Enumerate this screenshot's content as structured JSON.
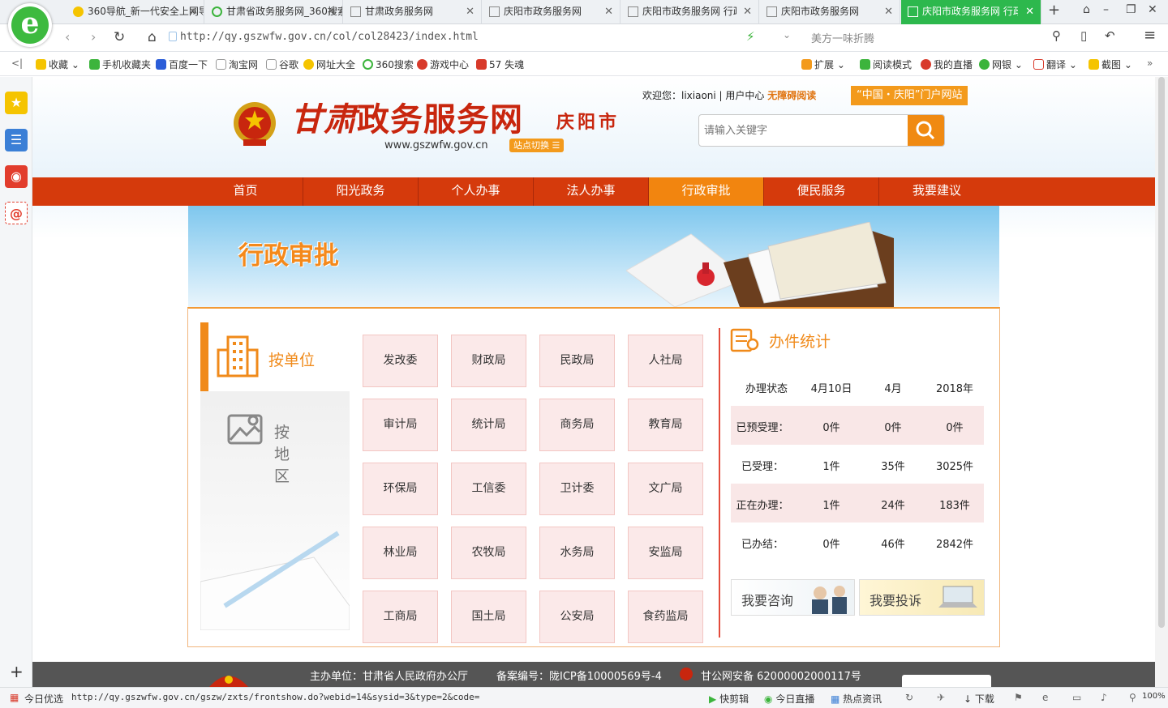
{
  "tabs": [
    {
      "label": "360导航_新一代安全上网导航",
      "icon": "360-nav-icon"
    },
    {
      "label": "甘肃省政务服务网_360搜索",
      "icon": "360-search-icon"
    },
    {
      "label": "甘肃政务服务网",
      "icon": "page-icon"
    },
    {
      "label": "庆阳市政务服务网",
      "icon": "page-icon"
    },
    {
      "label": "庆阳市政务服务网 行政审批",
      "icon": "page-icon"
    },
    {
      "label": "庆阳市政务服务网",
      "icon": "page-icon"
    },
    {
      "label": "庆阳市政务服务网 行政审批",
      "icon": "page-icon"
    }
  ],
  "address": {
    "url": "http://qy.gszwfw.gov.cn/col/col28423/index.html",
    "search_hint": "美方一味折腾"
  },
  "bookmarks": [
    "收藏",
    "手机收藏夹",
    "百度一下",
    "淘宝网",
    "谷歌",
    "网址大全",
    "360搜索",
    "游戏中心",
    "57 失魂"
  ],
  "bookmark_tools": [
    "扩展",
    "阅读模式",
    "我的直播",
    "网银",
    "翻译",
    "截图"
  ],
  "header": {
    "brand_calligraphy": "甘肃",
    "brand": "政务服务网",
    "city": "庆阳市",
    "domain": "www.gszwfw.gov.cn",
    "switch": "站点切换",
    "welcome": "欢迎您：lixiaoni | 用户中心",
    "accessible": "无障碍阅读",
    "portal": "“中国・庆阳”门户网站",
    "search_placeholder": "请输入关键字"
  },
  "nav": [
    "首页",
    "阳光政务",
    "个人办事",
    "法人办事",
    "行政审批",
    "便民服务",
    "我要建议"
  ],
  "nav_active": 4,
  "banner_title": "行政审批",
  "tabs_side": [
    "按单位",
    "按地区"
  ],
  "departments": [
    "发改委",
    "财政局",
    "民政局",
    "人社局",
    "审计局",
    "统计局",
    "商务局",
    "教育局",
    "环保局",
    "工信委",
    "卫计委",
    "文广局",
    "林业局",
    "农牧局",
    "水务局",
    "安监局",
    "工商局",
    "国土局",
    "公安局",
    "食药监局"
  ],
  "stats": {
    "title": "办件统计",
    "header": [
      "办理状态",
      "4月10日",
      "4月",
      "2018年"
    ],
    "rows": [
      [
        "已预受理：",
        "0件",
        "0件",
        "0件"
      ],
      [
        "已受理：",
        "1件",
        "35件",
        "3025件"
      ],
      [
        "正在办理：",
        "1件",
        "24件",
        "183件"
      ],
      [
        "已办结：",
        "0件",
        "46件",
        "2842件"
      ]
    ]
  },
  "actions": {
    "consult": "我要咨询",
    "complain": "我要投诉"
  },
  "footer": {
    "host": "主办单位：甘肃省人民政府办公厅",
    "icp": "备案编号：陇ICP备10000569号-4",
    "police": "甘公网安备 62000002000117号"
  },
  "status": {
    "news": "今日优选",
    "url": "http://qy.gszwfw.gov.cn/gszw/zxts/frontshow.do?webid=14&sysid=3&type=2&code=",
    "items": [
      "快剪辑",
      "今日直播",
      "热点资讯",
      "下载"
    ],
    "zoom": "100%"
  },
  "colors": {
    "nav": "#d53a0c",
    "accent": "#f08a12",
    "tab_active": "#2db84d"
  }
}
